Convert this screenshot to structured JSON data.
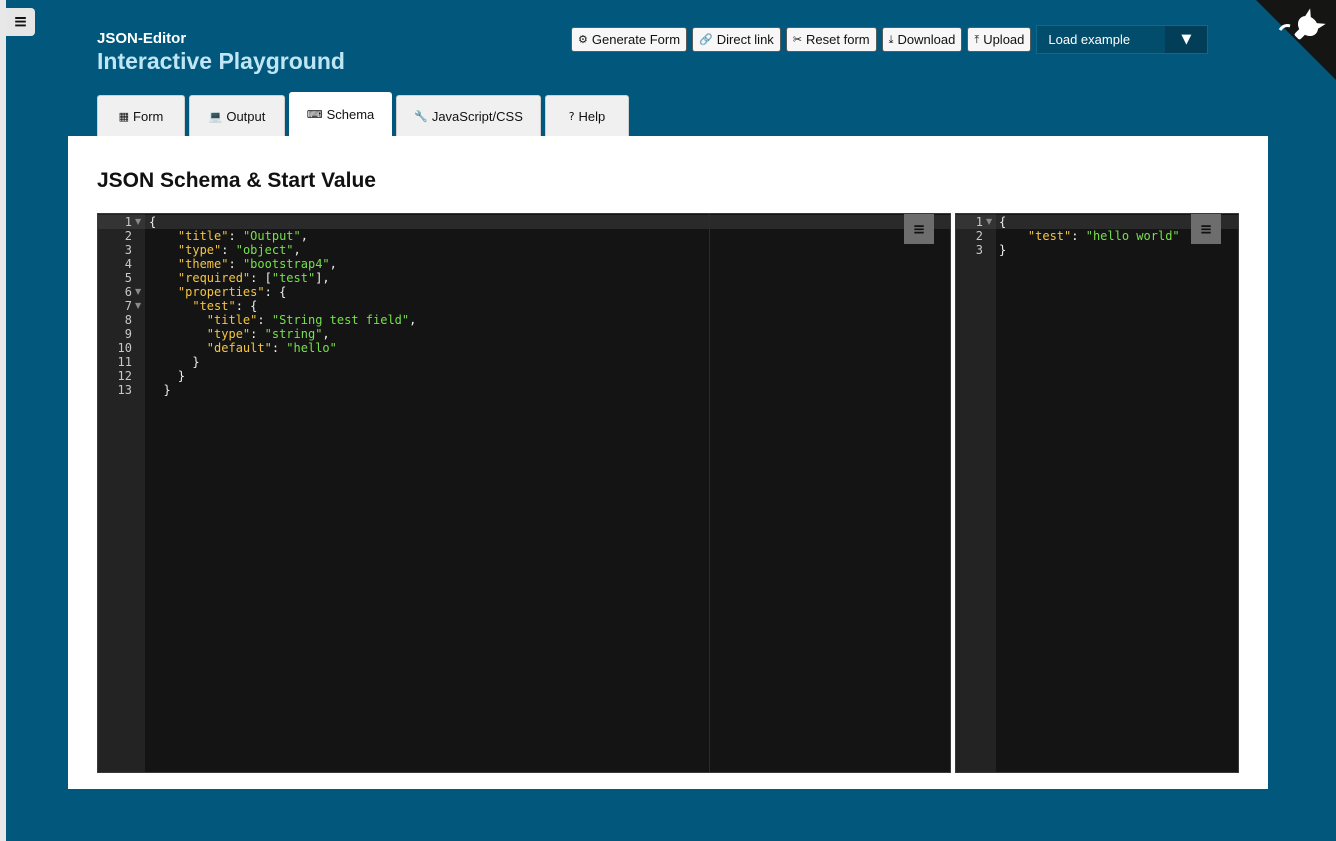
{
  "header": {
    "title": "JSON-Editor",
    "subtitle": "Interactive Playground"
  },
  "toolbar": {
    "generate_form": "Generate Form",
    "direct_link": "Direct link",
    "reset_form": "Reset form",
    "download": "Download",
    "upload": "Upload",
    "load_example": "Load example",
    "load_example_arrow": "▼"
  },
  "menu": {
    "icon_glyph": "≡"
  },
  "tabs": [
    {
      "label": "Form",
      "icon": "form-icon",
      "glyph": "▦"
    },
    {
      "label": "Output",
      "icon": "laptop-icon",
      "glyph": "💻"
    },
    {
      "label": "Schema",
      "icon": "keyboard-icon",
      "glyph": "⌨"
    },
    {
      "label": "JavaScript/CSS",
      "icon": "wrench-icon",
      "glyph": "🔧"
    },
    {
      "label": "Help",
      "icon": "question-icon",
      "glyph": "?"
    }
  ],
  "active_tab": "Schema",
  "panel": {
    "title": "JSON Schema & Start Value"
  },
  "schema_editor": {
    "lines": [
      "{",
      "    \"title\": \"Output\",",
      "    \"type\": \"object\",",
      "    \"theme\": \"bootstrap4\",",
      "    \"required\": [\"test\"],",
      "    \"properties\": {",
      "      \"test\": {",
      "        \"title\": \"String test field\",",
      "        \"type\": \"string\",",
      "        \"default\": \"hello\"",
      "      }",
      "    }",
      "  }"
    ],
    "folds": [
      1,
      6,
      7
    ]
  },
  "value_editor": {
    "lines": [
      "{",
      "    \"test\": \"hello world\"",
      "}"
    ],
    "folds": [
      1
    ]
  },
  "colors": {
    "background": "#02587c",
    "editor_bg": "#141414",
    "key": "#f5c542",
    "string": "#76e04b"
  }
}
